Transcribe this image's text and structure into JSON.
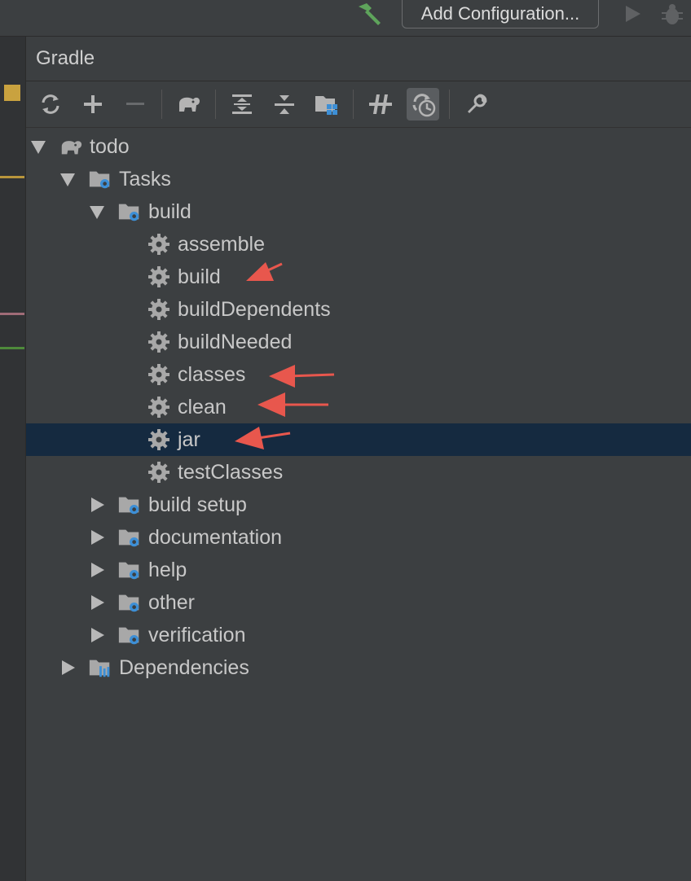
{
  "toolbar": {
    "config_label": "Add Configuration...",
    "icons": [
      "hammer-icon",
      "run-icon",
      "debug-icon"
    ]
  },
  "panel": {
    "title": "Gradle",
    "toolbar_icons": [
      "refresh-icon",
      "add-icon",
      "remove-icon",
      "elephant-icon",
      "expand-all-icon",
      "collapse-all-icon",
      "group-modules-icon",
      "toggle-offline-icon",
      "show-history-icon",
      "settings-wrench-icon"
    ]
  },
  "tree": {
    "root": "todo",
    "tasks": "Tasks",
    "build_group": "build",
    "build_tasks": [
      "assemble",
      "build",
      "buildDependents",
      "buildNeeded",
      "classes",
      "clean",
      "jar",
      "testClasses"
    ],
    "selected_task": "jar",
    "other_groups": [
      "build setup",
      "documentation",
      "help",
      "other",
      "verification"
    ],
    "dependencies": "Dependencies"
  },
  "colors": {
    "background": "#3c3f41",
    "selection": "#152a40",
    "folder_gear": "#3d8fd6",
    "annotation_arrow": "#e8574d"
  }
}
